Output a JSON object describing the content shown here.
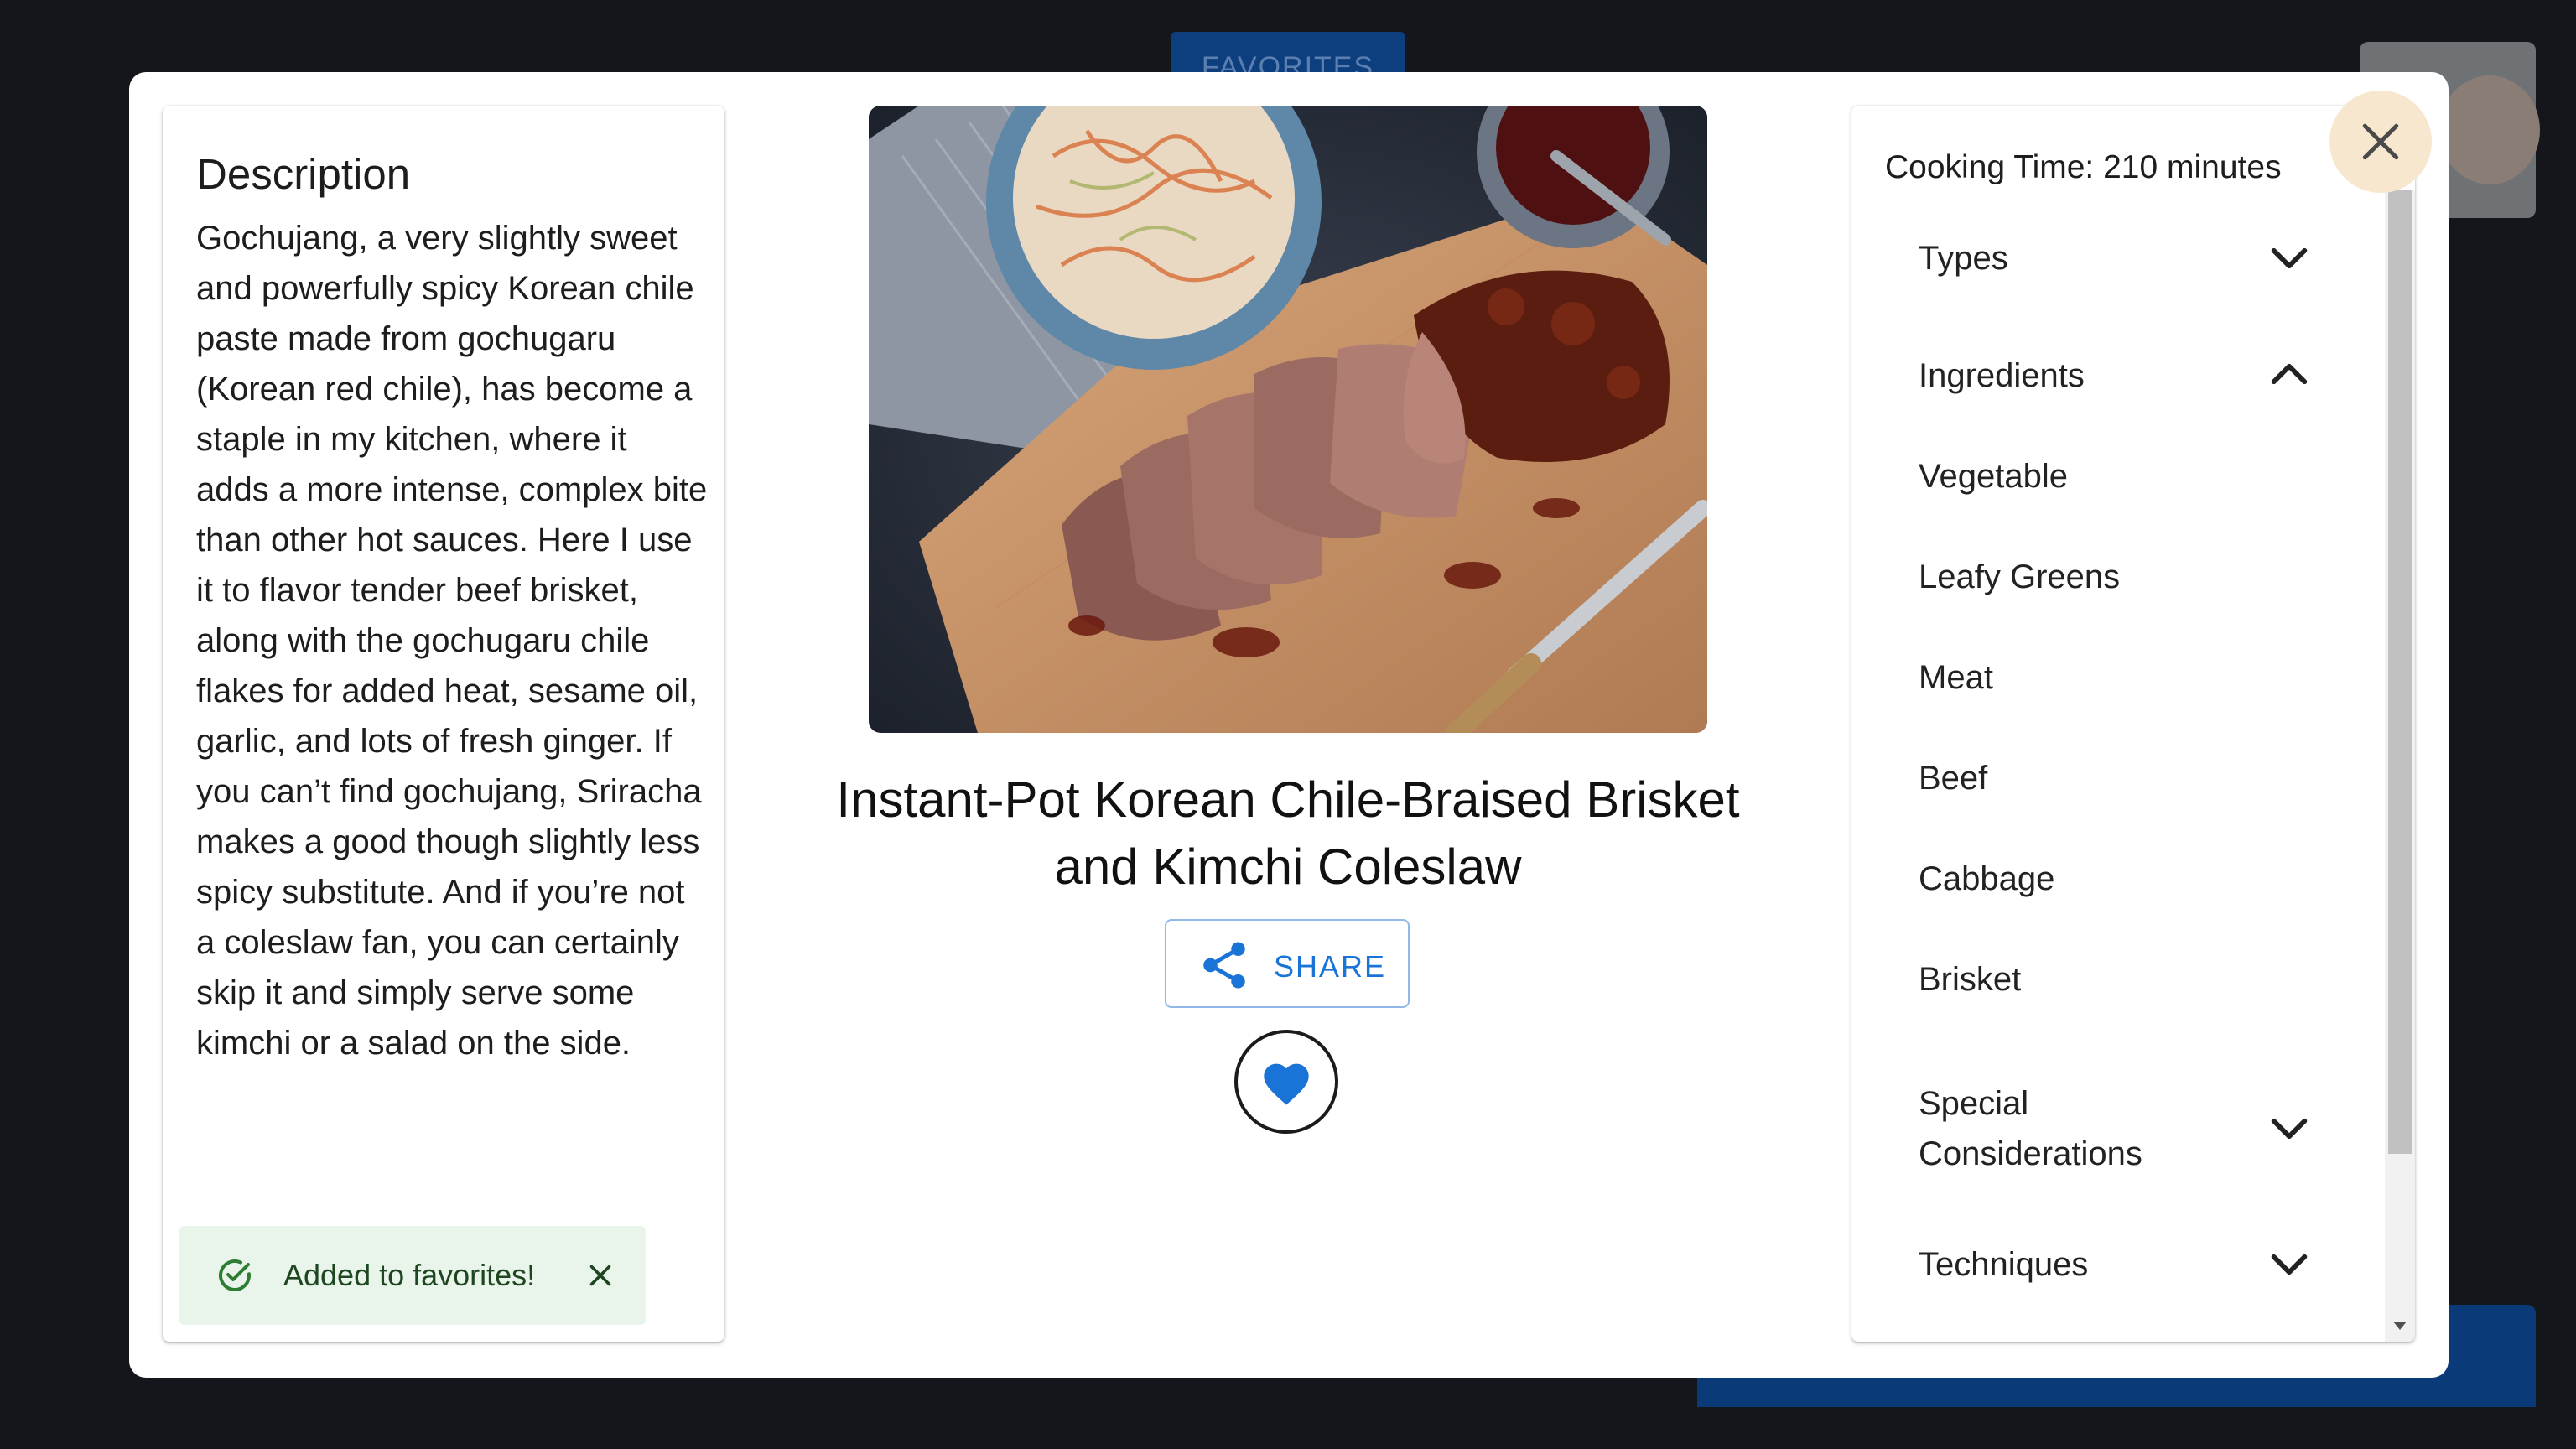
{
  "background": {
    "favorites_label": "FAVORITES"
  },
  "description": {
    "heading": "Description",
    "text": "Gochujang, a very slightly sweet and powerfully spicy Korean chile paste made from gochugaru (Korean red chile), has become a staple in my kitchen, where it adds a more intense, complex bite than other hot sauces. Here I use it to flavor tender beef brisket, along with the gochugaru chile flakes for added heat, sesame oil, garlic, and lots of fresh ginger. If you can’t find gochujang, Sriracha makes a good though slightly less spicy substitute. And if you’re not a coleslaw fan, you can certainly skip it and simply serve some kimchi or a salad on the side."
  },
  "snackbar": {
    "message": "Added to favorites!",
    "icon": "check-circle-icon",
    "close_icon": "close-icon",
    "color": "#e9f4ea"
  },
  "recipe": {
    "title": "Instant-Pot Korean Chile-Braised Brisket and Kimchi Coleslaw",
    "share_label": "SHARE",
    "favorite_icon": "heart-icon",
    "accent": "#1a73d6"
  },
  "details": {
    "cooking_time": "Cooking Time: 210 minutes",
    "sections": {
      "types": "Types",
      "ingredients": "Ingredients",
      "special": "Special Considerations",
      "techniques": "Techniques"
    },
    "ingredients": [
      "Vegetable",
      "Leafy Greens",
      "Meat",
      "Beef",
      "Cabbage",
      "Brisket"
    ]
  }
}
